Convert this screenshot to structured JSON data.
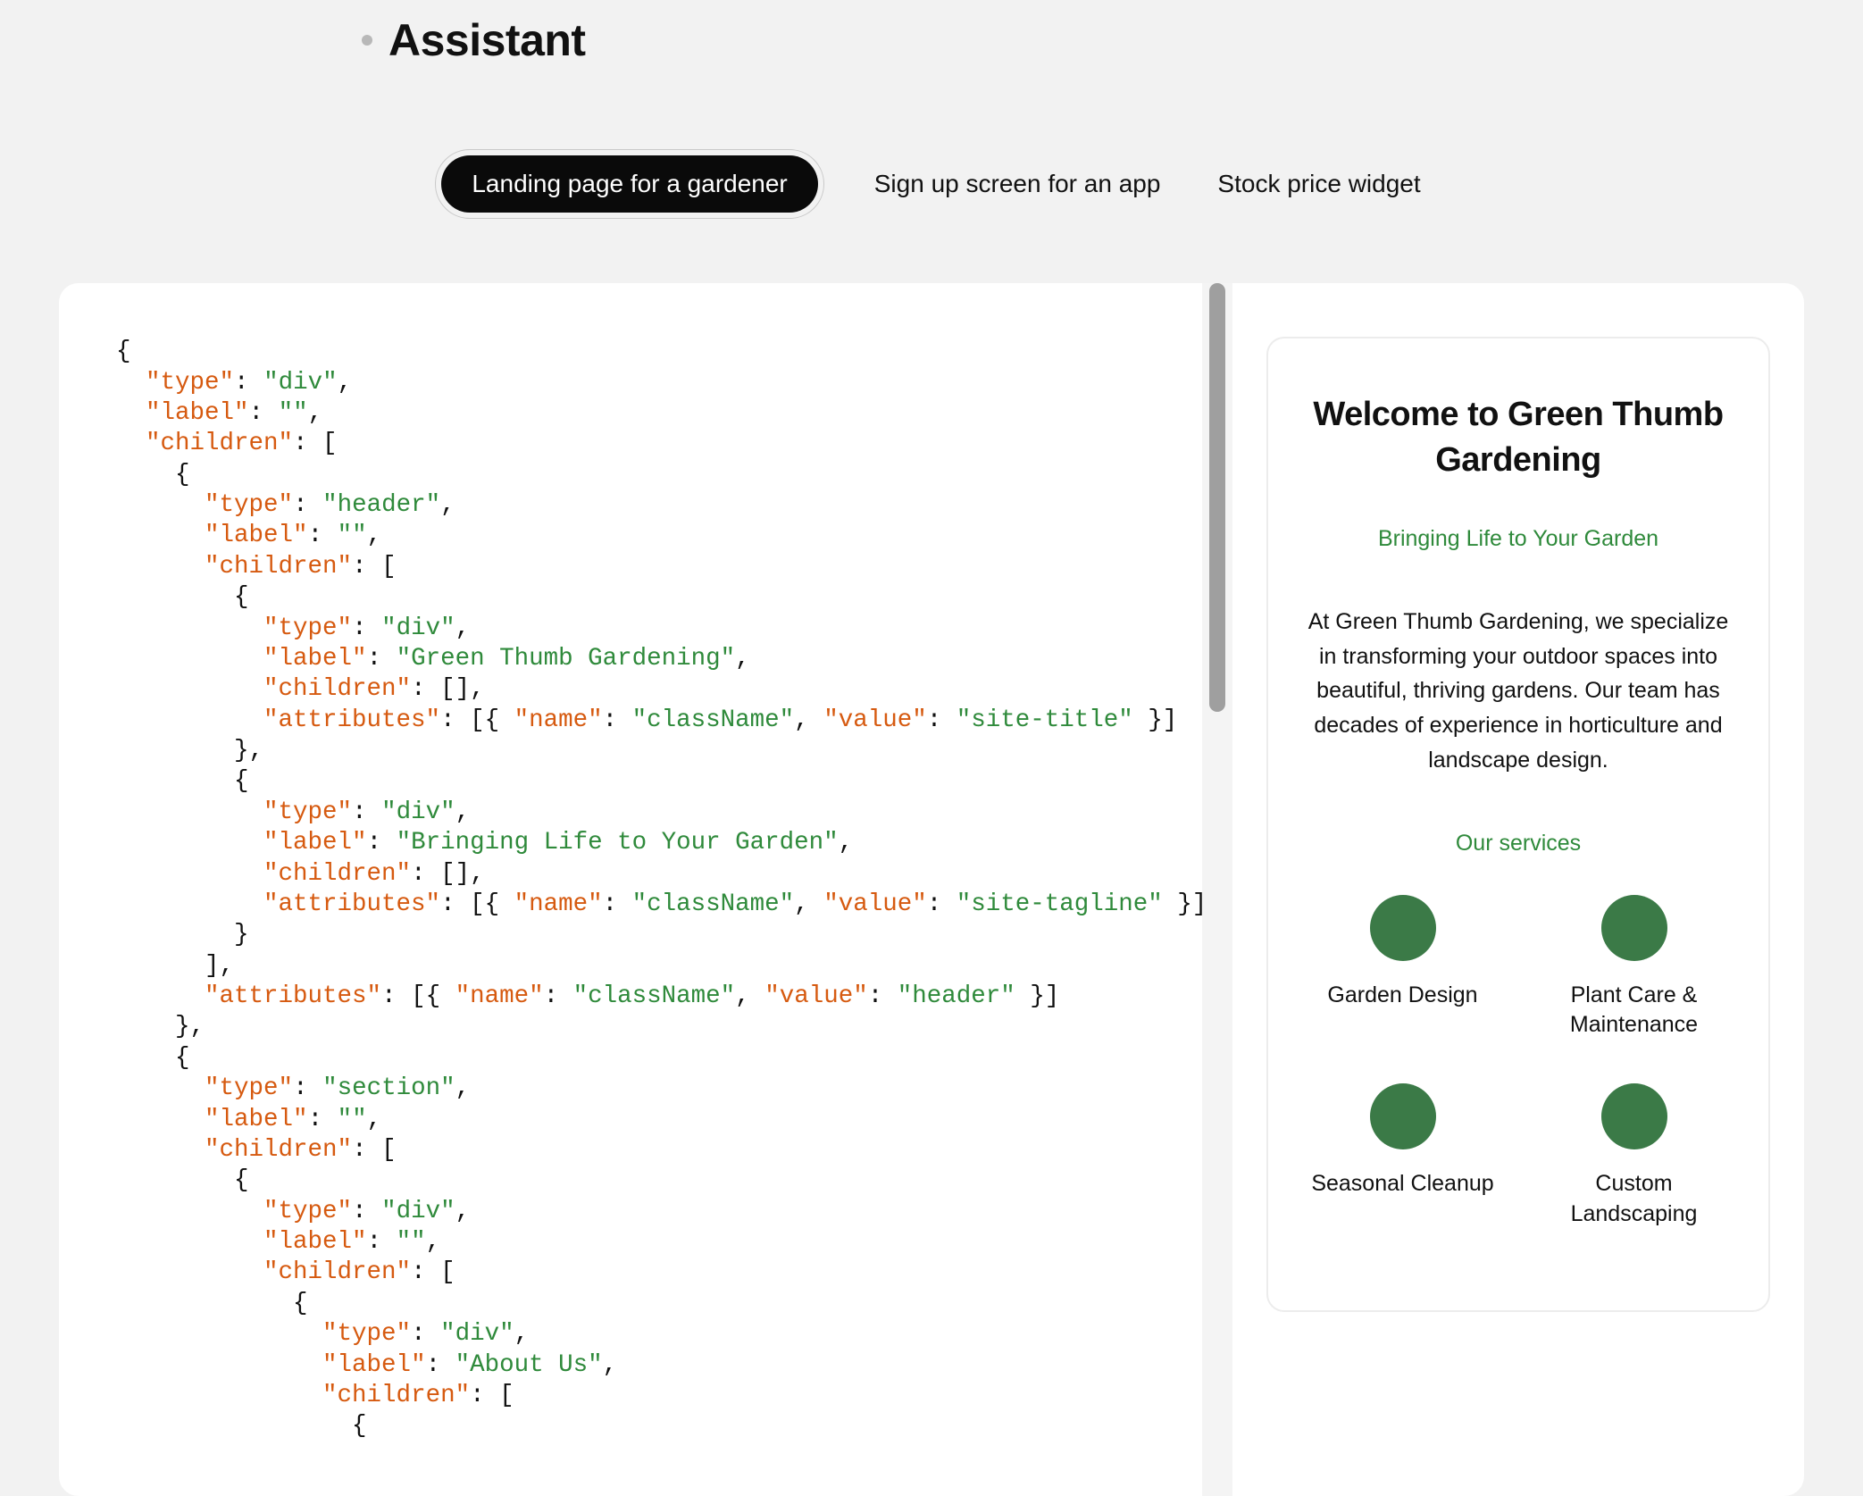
{
  "header": {
    "role_label": "Assistant"
  },
  "tabs": {
    "items": [
      {
        "label": "Landing page for a gardener",
        "active": true
      },
      {
        "label": "Sign up screen for an app",
        "active": false
      },
      {
        "label": "Stock price widget",
        "active": false
      }
    ]
  },
  "code": {
    "tokens": [
      [
        [
          "punct",
          "{"
        ]
      ],
      [
        [
          "indent",
          "  "
        ],
        [
          "key",
          "\"type\""
        ],
        [
          "punct",
          ": "
        ],
        [
          "str",
          "\"div\""
        ],
        [
          "punct",
          ","
        ]
      ],
      [
        [
          "indent",
          "  "
        ],
        [
          "key",
          "\"label\""
        ],
        [
          "punct",
          ": "
        ],
        [
          "str",
          "\"\""
        ],
        [
          "punct",
          ","
        ]
      ],
      [
        [
          "indent",
          "  "
        ],
        [
          "key",
          "\"children\""
        ],
        [
          "punct",
          ": ["
        ]
      ],
      [
        [
          "indent",
          "    "
        ],
        [
          "punct",
          "{"
        ]
      ],
      [
        [
          "indent",
          "      "
        ],
        [
          "key",
          "\"type\""
        ],
        [
          "punct",
          ": "
        ],
        [
          "str",
          "\"header\""
        ],
        [
          "punct",
          ","
        ]
      ],
      [
        [
          "indent",
          "      "
        ],
        [
          "key",
          "\"label\""
        ],
        [
          "punct",
          ": "
        ],
        [
          "str",
          "\"\""
        ],
        [
          "punct",
          ","
        ]
      ],
      [
        [
          "indent",
          "      "
        ],
        [
          "key",
          "\"children\""
        ],
        [
          "punct",
          ": ["
        ]
      ],
      [
        [
          "indent",
          "        "
        ],
        [
          "punct",
          "{"
        ]
      ],
      [
        [
          "indent",
          "          "
        ],
        [
          "key",
          "\"type\""
        ],
        [
          "punct",
          ": "
        ],
        [
          "str",
          "\"div\""
        ],
        [
          "punct",
          ","
        ]
      ],
      [
        [
          "indent",
          "          "
        ],
        [
          "key",
          "\"label\""
        ],
        [
          "punct",
          ": "
        ],
        [
          "str",
          "\"Green Thumb Gardening\""
        ],
        [
          "punct",
          ","
        ]
      ],
      [
        [
          "indent",
          "          "
        ],
        [
          "key",
          "\"children\""
        ],
        [
          "punct",
          ": [],"
        ]
      ],
      [
        [
          "indent",
          "          "
        ],
        [
          "key",
          "\"attributes\""
        ],
        [
          "punct",
          ": [{ "
        ],
        [
          "key",
          "\"name\""
        ],
        [
          "punct",
          ": "
        ],
        [
          "str",
          "\"className\""
        ],
        [
          "punct",
          ", "
        ],
        [
          "key",
          "\"value\""
        ],
        [
          "punct",
          ": "
        ],
        [
          "str",
          "\"site-title\""
        ],
        [
          "punct",
          " }]"
        ]
      ],
      [
        [
          "indent",
          "        "
        ],
        [
          "punct",
          "},"
        ]
      ],
      [
        [
          "indent",
          "        "
        ],
        [
          "punct",
          "{"
        ]
      ],
      [
        [
          "indent",
          "          "
        ],
        [
          "key",
          "\"type\""
        ],
        [
          "punct",
          ": "
        ],
        [
          "str",
          "\"div\""
        ],
        [
          "punct",
          ","
        ]
      ],
      [
        [
          "indent",
          "          "
        ],
        [
          "key",
          "\"label\""
        ],
        [
          "punct",
          ": "
        ],
        [
          "str",
          "\"Bringing Life to Your Garden\""
        ],
        [
          "punct",
          ","
        ]
      ],
      [
        [
          "indent",
          "          "
        ],
        [
          "key",
          "\"children\""
        ],
        [
          "punct",
          ": [],"
        ]
      ],
      [
        [
          "indent",
          "          "
        ],
        [
          "key",
          "\"attributes\""
        ],
        [
          "punct",
          ": [{ "
        ],
        [
          "key",
          "\"name\""
        ],
        [
          "punct",
          ": "
        ],
        [
          "str",
          "\"className\""
        ],
        [
          "punct",
          ", "
        ],
        [
          "key",
          "\"value\""
        ],
        [
          "punct",
          ": "
        ],
        [
          "str",
          "\"site-tagline\""
        ],
        [
          "punct",
          " }]"
        ]
      ],
      [
        [
          "indent",
          "        "
        ],
        [
          "punct",
          "}"
        ]
      ],
      [
        [
          "indent",
          "      "
        ],
        [
          "punct",
          "],"
        ]
      ],
      [
        [
          "indent",
          "      "
        ],
        [
          "key",
          "\"attributes\""
        ],
        [
          "punct",
          ": [{ "
        ],
        [
          "key",
          "\"name\""
        ],
        [
          "punct",
          ": "
        ],
        [
          "str",
          "\"className\""
        ],
        [
          "punct",
          ", "
        ],
        [
          "key",
          "\"value\""
        ],
        [
          "punct",
          ": "
        ],
        [
          "str",
          "\"header\""
        ],
        [
          "punct",
          " }]"
        ]
      ],
      [
        [
          "indent",
          "    "
        ],
        [
          "punct",
          "},"
        ]
      ],
      [
        [
          "indent",
          "    "
        ],
        [
          "punct",
          "{"
        ]
      ],
      [
        [
          "indent",
          "      "
        ],
        [
          "key",
          "\"type\""
        ],
        [
          "punct",
          ": "
        ],
        [
          "str",
          "\"section\""
        ],
        [
          "punct",
          ","
        ]
      ],
      [
        [
          "indent",
          "      "
        ],
        [
          "key",
          "\"label\""
        ],
        [
          "punct",
          ": "
        ],
        [
          "str",
          "\"\""
        ],
        [
          "punct",
          ","
        ]
      ],
      [
        [
          "indent",
          "      "
        ],
        [
          "key",
          "\"children\""
        ],
        [
          "punct",
          ": ["
        ]
      ],
      [
        [
          "indent",
          "        "
        ],
        [
          "punct",
          "{"
        ]
      ],
      [
        [
          "indent",
          "          "
        ],
        [
          "key",
          "\"type\""
        ],
        [
          "punct",
          ": "
        ],
        [
          "str",
          "\"div\""
        ],
        [
          "punct",
          ","
        ]
      ],
      [
        [
          "indent",
          "          "
        ],
        [
          "key",
          "\"label\""
        ],
        [
          "punct",
          ": "
        ],
        [
          "str",
          "\"\""
        ],
        [
          "punct",
          ","
        ]
      ],
      [
        [
          "indent",
          "          "
        ],
        [
          "key",
          "\"children\""
        ],
        [
          "punct",
          ": ["
        ]
      ],
      [
        [
          "indent",
          "            "
        ],
        [
          "punct",
          "{"
        ]
      ],
      [
        [
          "indent",
          "              "
        ],
        [
          "key",
          "\"type\""
        ],
        [
          "punct",
          ": "
        ],
        [
          "str",
          "\"div\""
        ],
        [
          "punct",
          ","
        ]
      ],
      [
        [
          "indent",
          "              "
        ],
        [
          "key",
          "\"label\""
        ],
        [
          "punct",
          ": "
        ],
        [
          "str",
          "\"About Us\""
        ],
        [
          "punct",
          ","
        ]
      ],
      [
        [
          "indent",
          "              "
        ],
        [
          "key",
          "\"children\""
        ],
        [
          "punct",
          ": ["
        ]
      ],
      [
        [
          "indent",
          "                "
        ],
        [
          "punct",
          "{"
        ]
      ]
    ]
  },
  "preview": {
    "title": "Welcome to Green Thumb Gardening",
    "tagline": "Bringing Life to Your Garden",
    "body": "At Green Thumb Gardening, we specialize in transforming your outdoor spaces into beautiful, thriving gardens. Our team has decades of experience in horticulture and landscape design.",
    "services_label": "Our services",
    "services": [
      "Garden Design",
      "Plant Care & Maintenance",
      "Seasonal Cleanup",
      "Custom Landscaping"
    ]
  },
  "colors": {
    "accent_green": "#2f8a3b",
    "service_dot": "#3b7a47",
    "code_key": "#d65a10",
    "code_string": "#2f8a3b"
  }
}
